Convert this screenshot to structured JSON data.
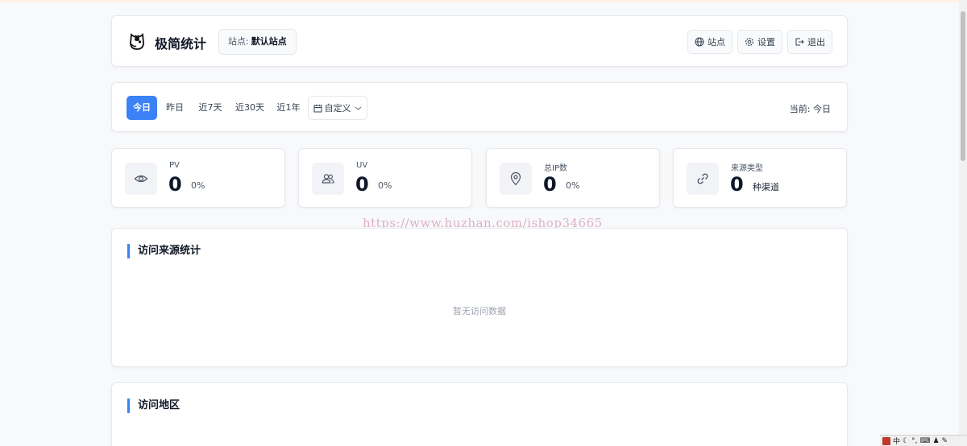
{
  "app": {
    "title": "极简统计",
    "site_label": "站点:",
    "site_value": "默认站点"
  },
  "header_buttons": {
    "sites": "站点",
    "settings": "设置",
    "logout": "退出"
  },
  "filter": {
    "tabs": [
      "今日",
      "昨日",
      "近7天",
      "近30天",
      "近1年"
    ],
    "active_tab": "今日",
    "custom_label": "自定义",
    "current_text": "当前: 今日"
  },
  "stats": [
    {
      "label": "PV",
      "value": "0",
      "suffix": "0%",
      "icon": "eye-icon"
    },
    {
      "label": "UV",
      "value": "0",
      "suffix": "0%",
      "icon": "users-icon"
    },
    {
      "label": "总IP数",
      "value": "0",
      "suffix": "0%",
      "icon": "location-pin-icon"
    },
    {
      "label": "来源类型",
      "value": "0",
      "suffix": "种渠道",
      "icon": "link-icon"
    }
  ],
  "sections": {
    "sources": {
      "title": "访问来源统计",
      "empty_text": "暂无访问数据"
    },
    "regions": {
      "title": "访问地区"
    }
  },
  "watermark": "https://www.huzhan.com/ishop34665",
  "tray": {
    "ime": "中"
  },
  "colors": {
    "accent": "#3b82f6",
    "background": "#f8f9fb"
  }
}
